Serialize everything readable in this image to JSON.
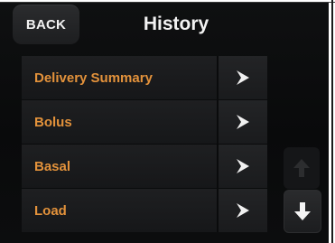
{
  "header": {
    "back_label": "BACK",
    "title": "History"
  },
  "menu": {
    "items": [
      {
        "label": "Delivery Summary",
        "icon": "chevron-right-icon"
      },
      {
        "label": "Bolus",
        "icon": "chevron-right-icon"
      },
      {
        "label": "Basal",
        "icon": "chevron-right-icon"
      },
      {
        "label": "Load",
        "icon": "chevron-right-icon"
      }
    ]
  },
  "scroll": {
    "up_icon": "arrow-up-icon",
    "up_state": "disabled",
    "down_icon": "arrow-down-icon",
    "down_state": "enabled"
  },
  "colors": {
    "accent": "#e3923b",
    "background": "#0b0c0d",
    "text": "#f3f3f3"
  }
}
